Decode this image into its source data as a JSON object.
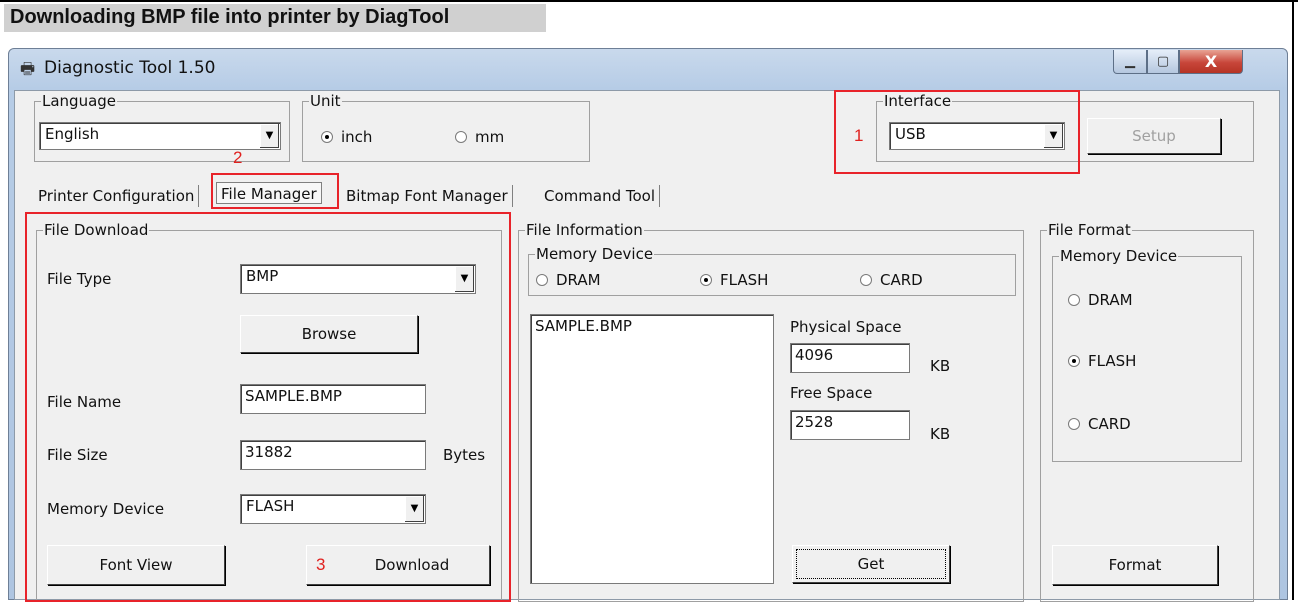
{
  "heading": "Downloading BMP file into printer by DiagTool",
  "window": {
    "title": "Diagnostic Tool 1.50",
    "close_glyph": "X"
  },
  "language": {
    "legend": "Language",
    "value": "English"
  },
  "unit": {
    "legend": "Unit",
    "options": [
      "inch",
      "mm"
    ],
    "selected": "inch"
  },
  "interface": {
    "legend": "Interface",
    "value": "USB",
    "setup_label": "Setup"
  },
  "tabs": [
    "Printer Configuration",
    "File Manager",
    "Bitmap Font Manager",
    "Command Tool"
  ],
  "active_tab": "File Manager",
  "file_download": {
    "legend": "File Download",
    "file_type_label": "File Type",
    "file_type_value": "BMP",
    "browse_label": "Browse",
    "file_name_label": "File Name",
    "file_name_value": "SAMPLE.BMP",
    "file_size_label": "File Size",
    "file_size_value": "31882",
    "file_size_unit": "Bytes",
    "memory_device_label": "Memory Device",
    "memory_device_value": "FLASH",
    "font_view_label": "Font View",
    "download_label": "Download"
  },
  "file_information": {
    "legend": "File Information",
    "memory_device_legend": "Memory Device",
    "options": [
      "DRAM",
      "FLASH",
      "CARD"
    ],
    "selected": "FLASH",
    "files": [
      "SAMPLE.BMP"
    ],
    "physical_space_label": "Physical Space",
    "physical_space_value": "4096",
    "free_space_label": "Free Space",
    "free_space_value": "2528",
    "unit": "KB",
    "get_label": "Get"
  },
  "file_format": {
    "legend": "File Format",
    "memory_device_legend": "Memory Device",
    "options": [
      "DRAM",
      "FLASH",
      "CARD"
    ],
    "selected": "FLASH",
    "format_label": "Format"
  },
  "annotations": [
    "1",
    "2",
    "3"
  ],
  "colors": {
    "annotation_red": "#e8232a",
    "heading_bg": "#d0d0d0"
  }
}
